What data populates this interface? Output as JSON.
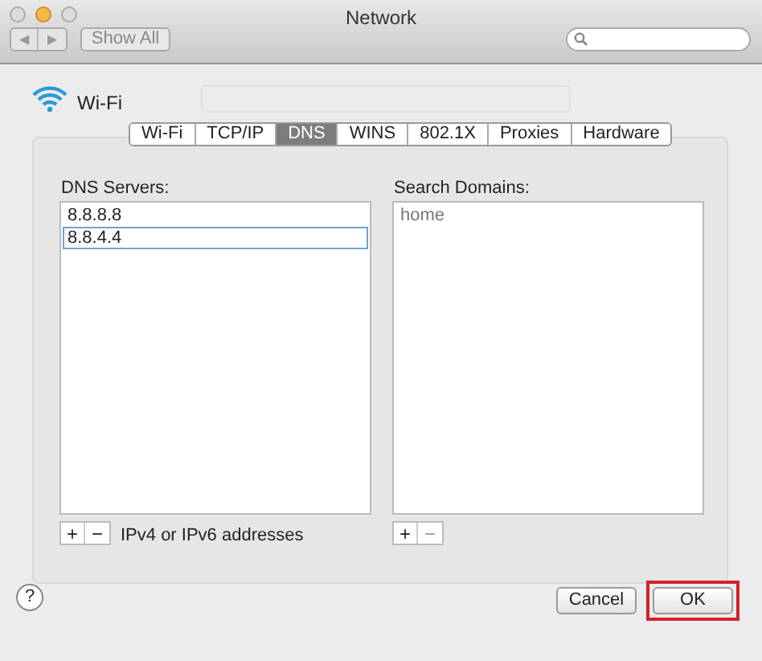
{
  "window": {
    "title": "Network"
  },
  "toolbar": {
    "back": "◀",
    "forward": "▶",
    "show_all": "Show All"
  },
  "service": {
    "name": "Wi-Fi"
  },
  "tabs": [
    {
      "label": "Wi-Fi",
      "selected": false
    },
    {
      "label": "TCP/IP",
      "selected": false
    },
    {
      "label": "DNS",
      "selected": true
    },
    {
      "label": "WINS",
      "selected": false
    },
    {
      "label": "802.1X",
      "selected": false
    },
    {
      "label": "Proxies",
      "selected": false
    },
    {
      "label": "Hardware",
      "selected": false
    }
  ],
  "dns_servers": {
    "label": "DNS Servers:",
    "items": [
      {
        "text": "8.8.8.8",
        "selected": false
      },
      {
        "text": "8.8.4.4",
        "selected": true
      }
    ],
    "add": "+",
    "remove": "−",
    "hint": "IPv4 or IPv6 addresses"
  },
  "search_domains": {
    "label": "Search Domains:",
    "items": [
      {
        "text": "home",
        "selected": false
      }
    ],
    "add": "+",
    "remove": "−"
  },
  "help": "?",
  "buttons": [
    {
      "label": "Cancel",
      "highlighted": false
    },
    {
      "label": "OK",
      "highlighted": true
    }
  ]
}
